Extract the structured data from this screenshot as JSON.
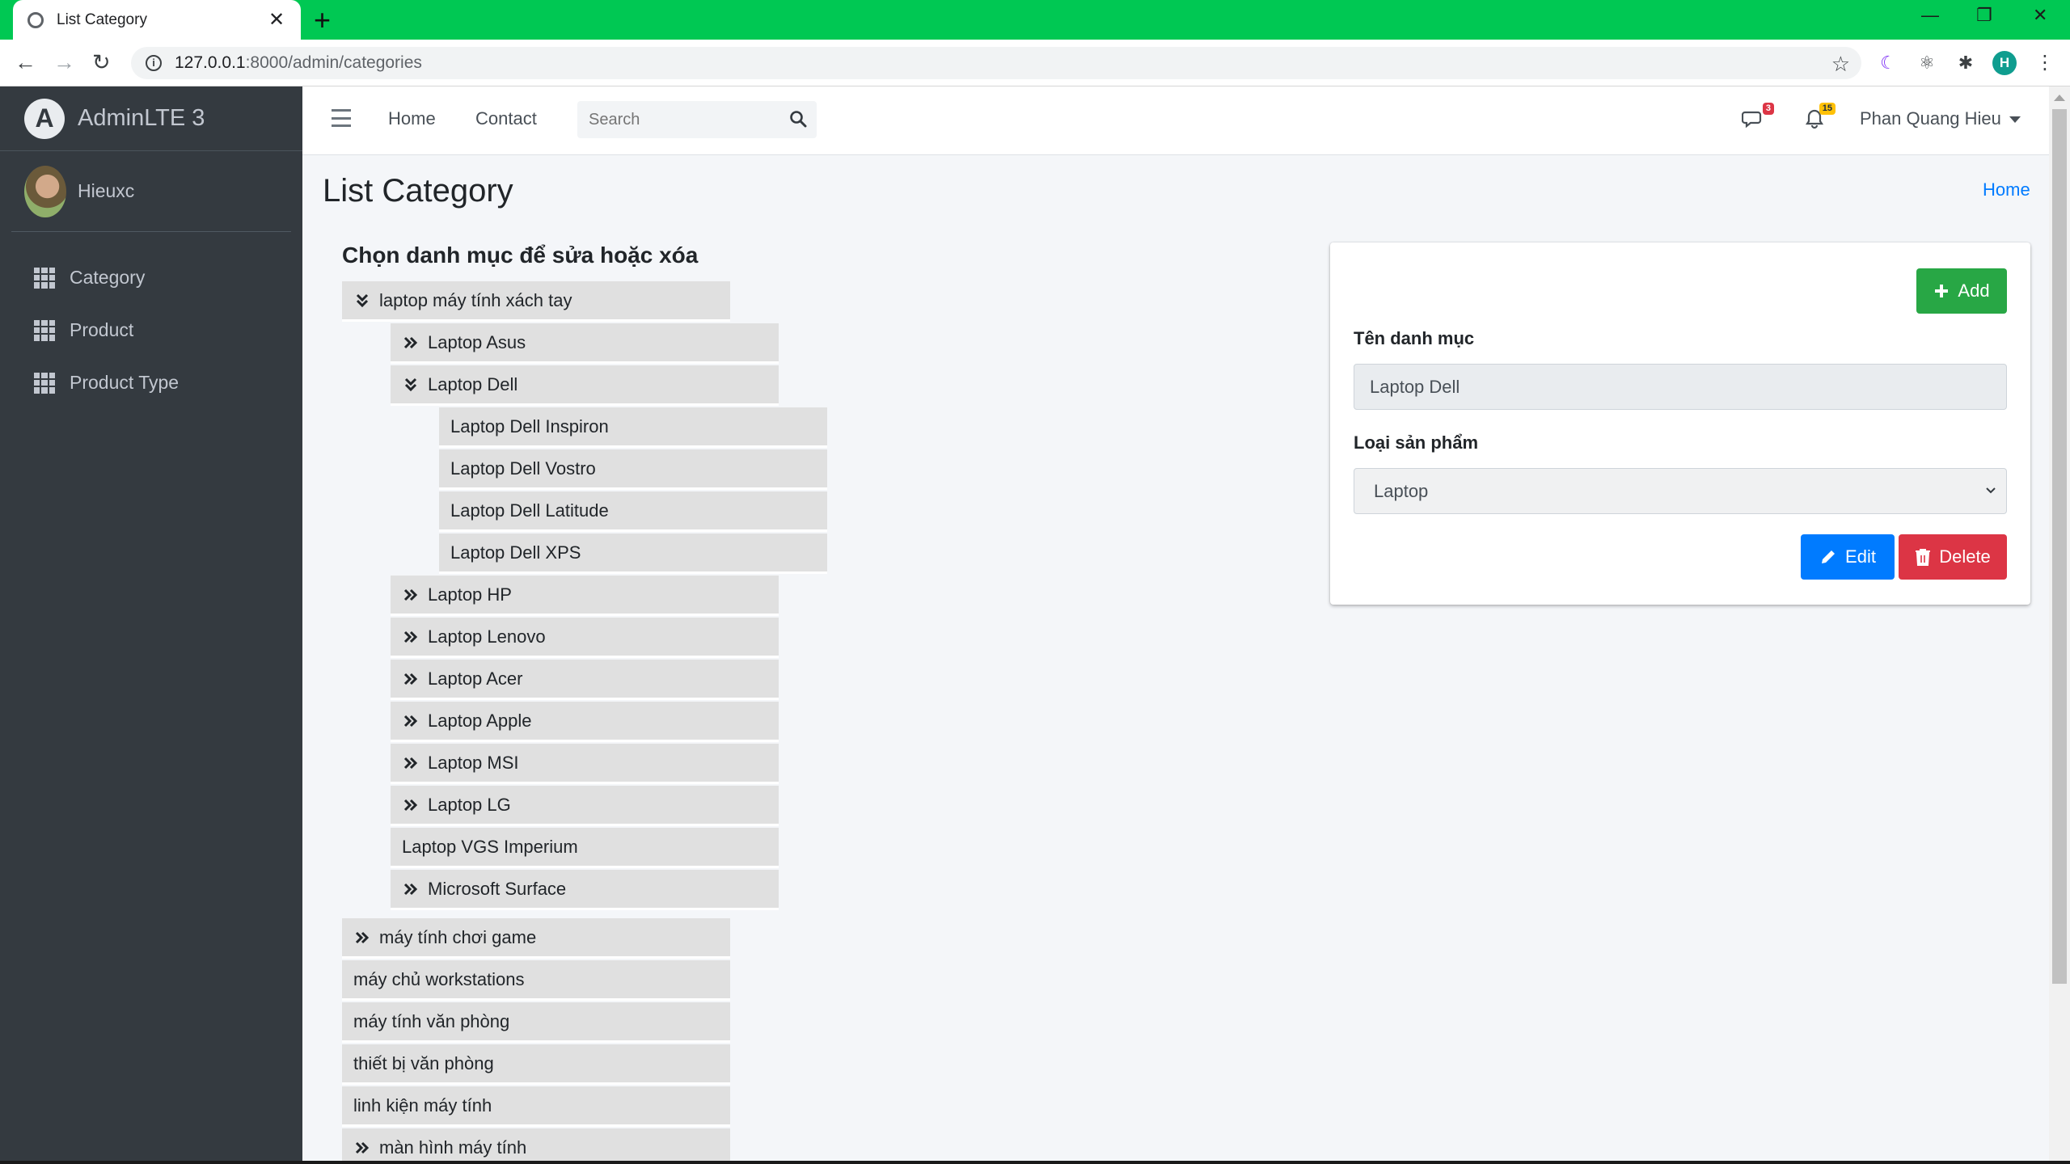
{
  "browser": {
    "tab_title": "List Category",
    "url_host": "127.0.0.1",
    "url_path": ":8000/admin/categories",
    "profile_initial": "H"
  },
  "sidebar": {
    "brand": "AdminLTE 3",
    "user_name": "Hieuxc",
    "items": [
      {
        "label": "Category"
      },
      {
        "label": "Product"
      },
      {
        "label": "Product Type"
      }
    ]
  },
  "topnav": {
    "home": "Home",
    "contact": "Contact",
    "search_placeholder": "Search",
    "messages_count": "3",
    "notifications_count": "15",
    "user_name": "Phan Quang Hieu"
  },
  "page": {
    "title": "List Category",
    "breadcrumb_home": "Home",
    "tree_heading": "Chọn danh mục để sửa hoặc xóa"
  },
  "tree": [
    {
      "label": "laptop máy tính xách tay",
      "icon": "chevron-down"
    },
    {
      "label": "Laptop Asus",
      "icon": "chevron-right"
    },
    {
      "label": "Laptop Dell",
      "icon": "chevron-down"
    },
    {
      "label": "Laptop Dell Inspiron",
      "icon": ""
    },
    {
      "label": "Laptop Dell Vostro",
      "icon": ""
    },
    {
      "label": "Laptop Dell Latitude",
      "icon": ""
    },
    {
      "label": "Laptop Dell XPS",
      "icon": ""
    },
    {
      "label": "Laptop HP",
      "icon": "chevron-right"
    },
    {
      "label": "Laptop Lenovo",
      "icon": "chevron-right"
    },
    {
      "label": "Laptop Acer",
      "icon": "chevron-right"
    },
    {
      "label": "Laptop Apple",
      "icon": "chevron-right"
    },
    {
      "label": "Laptop MSI",
      "icon": "chevron-right"
    },
    {
      "label": "Laptop LG",
      "icon": "chevron-right"
    },
    {
      "label": "Laptop VGS Imperium",
      "icon": ""
    },
    {
      "label": "Microsoft Surface",
      "icon": "chevron-right"
    },
    {
      "label": "máy tính chơi game",
      "icon": "chevron-right"
    },
    {
      "label": "máy chủ workstations",
      "icon": ""
    },
    {
      "label": "máy tính văn phòng",
      "icon": ""
    },
    {
      "label": "thiết bị văn phòng",
      "icon": ""
    },
    {
      "label": "linh kiện máy tính",
      "icon": ""
    },
    {
      "label": "màn hình máy tính",
      "icon": "chevron-right"
    }
  ],
  "form": {
    "add_label": "Add",
    "name_label": "Tên danh mục",
    "name_value": "Laptop Dell",
    "type_label": "Loại sản phẩm",
    "type_value": "Laptop",
    "edit_label": "Edit",
    "delete_label": "Delete"
  },
  "colors": {
    "tab_strip": "#00c853",
    "sidebar": "#343a40",
    "add_button": "#28a745",
    "edit_button": "#007bff",
    "delete_button": "#dc3545",
    "tree_item_bg": "#e0e0e0",
    "link": "#007bff"
  }
}
